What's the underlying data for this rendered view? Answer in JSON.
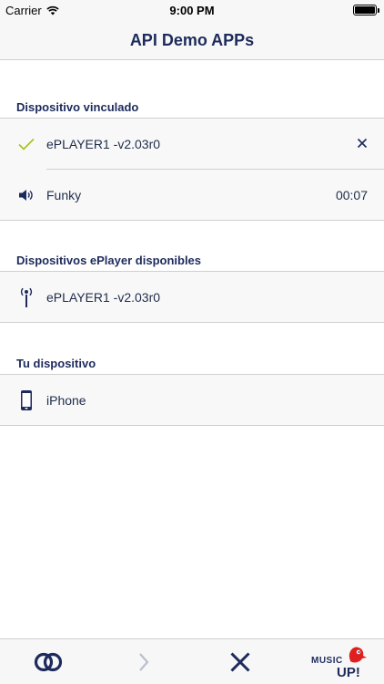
{
  "status_bar": {
    "carrier": "Carrier",
    "time": "9:00 PM"
  },
  "nav": {
    "title": "API Demo APPs"
  },
  "sections": {
    "linked": {
      "header": "Dispositivo vinculado",
      "device_name": "ePLAYER1 -v2.03r0",
      "track_name": "Funky",
      "track_time": "00:07"
    },
    "available": {
      "header": "Dispositivos ePlayer disponibles",
      "device_name": "ePLAYER1 -v2.03r0"
    },
    "own": {
      "header": "Tu dispositivo",
      "device_name": "iPhone"
    }
  },
  "tab_bar": {
    "brand": {
      "top": "MUSIC",
      "bottom": "UP!"
    }
  },
  "colors": {
    "brand_navy": "#1d2b5c",
    "check_green": "#a4c21a",
    "brand_red": "#e02020"
  }
}
